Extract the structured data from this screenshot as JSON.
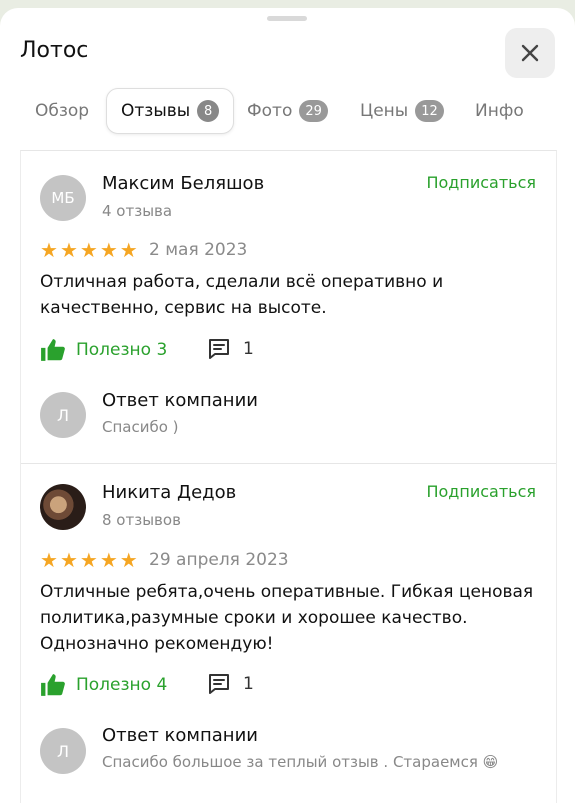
{
  "header": {
    "title": "Лотос",
    "close_icon": "close-icon"
  },
  "tabs": [
    {
      "label": "Обзор",
      "count": null,
      "active": false
    },
    {
      "label": "Отзывы",
      "count": "8",
      "active": true
    },
    {
      "label": "Фото",
      "count": "29",
      "active": false
    },
    {
      "label": "Цены",
      "count": "12",
      "active": false
    },
    {
      "label": "Инфо",
      "count": null,
      "active": false
    }
  ],
  "reviews": [
    {
      "avatar_initials": "МБ",
      "author": "Максим Беляшов",
      "author_reviews": "4 отзыва",
      "subscribe_label": "Подписаться",
      "rating": 5,
      "date": "2 мая 2023",
      "text": "Отличная работа, сделали всё оперативно и качественно, сервис на высоте.",
      "useful_label": "Полезно 3",
      "comments_count": "1",
      "reply": {
        "avatar_initial": "Л",
        "title": "Ответ компании",
        "text": "Спасибо )"
      }
    },
    {
      "avatar_initials": "",
      "author": "Никита Дедов",
      "author_reviews": "8 отзывов",
      "subscribe_label": "Подписаться",
      "rating": 5,
      "date": "29 апреля 2023",
      "text": "Отличные ребята,очень оперативные. Гибкая ценовая политика,разумные сроки и хорошее качество. Однозначно рекомендую!",
      "useful_label": "Полезно 4",
      "comments_count": "1",
      "reply": {
        "avatar_initial": "Л",
        "title": "Ответ компании",
        "text": "Спасибо большое за теплый отзыв . Стараемся 😁"
      }
    }
  ],
  "colors": {
    "accent_green": "#2aa12d",
    "star": "#f5a623",
    "muted": "#888888"
  }
}
